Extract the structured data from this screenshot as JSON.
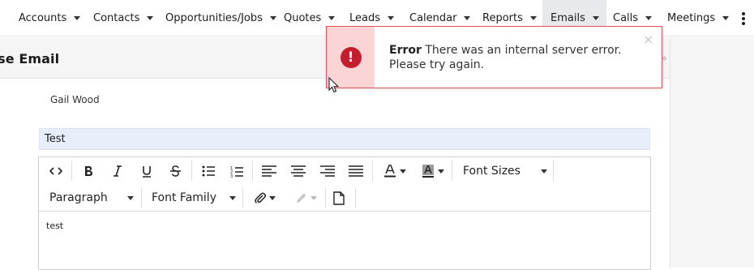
{
  "nav": {
    "items": [
      {
        "label": "Accounts"
      },
      {
        "label": "Contacts"
      },
      {
        "label": "Opportunities/Jobs"
      },
      {
        "label": "Quotes"
      },
      {
        "label": "Leads"
      },
      {
        "label": "Calendar"
      },
      {
        "label": "Reports"
      },
      {
        "label": "Emails"
      },
      {
        "label": "Calls"
      },
      {
        "label": "Meetings"
      }
    ],
    "active": "Emails"
  },
  "compose": {
    "title": "ose Email",
    "to_name": "Gail Wood",
    "subject": "Test",
    "body": "test"
  },
  "toolbar": {
    "font_sizes_label": "Font Sizes",
    "paragraph_label": "Paragraph",
    "font_family_label": "Font Family",
    "icons": [
      "code-view-icon",
      "bold-icon",
      "italic-icon",
      "underline-icon",
      "strikethrough-icon",
      "bullet-list-icon",
      "numbered-list-icon",
      "align-left-icon",
      "align-center-icon",
      "align-right-icon",
      "justify-icon",
      "font-color-icon",
      "highlight-color-icon",
      "attach-icon",
      "pencil-icon",
      "document-icon"
    ]
  },
  "toast": {
    "title": "Error",
    "message": "There was an internal server error. Please try again.",
    "close": "×",
    "icon": "!",
    "accent_color": "#c41d2d",
    "side_color": "#fbd4d6"
  },
  "rail": {
    "collapse_glyph": "»"
  }
}
